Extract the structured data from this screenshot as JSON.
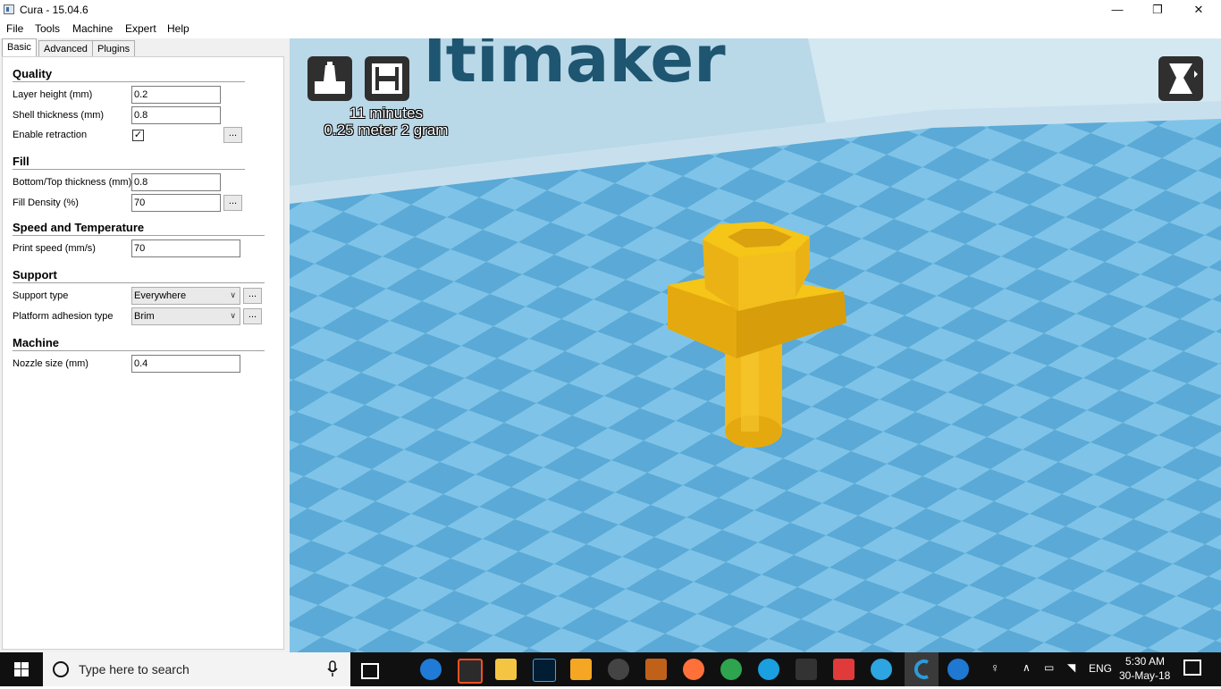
{
  "window": {
    "title": "Cura - 15.04.6",
    "minimize_icon": "minimize-icon",
    "maximize_icon": "restore-icon",
    "close_icon": "close-icon"
  },
  "menu": [
    "File",
    "Tools",
    "Machine",
    "Expert",
    "Help"
  ],
  "tabs": [
    "Basic",
    "Advanced",
    "Plugins"
  ],
  "sections": {
    "quality": {
      "title": "Quality",
      "layer_height_label": "Layer height (mm)",
      "layer_height": "0.2",
      "shell_thickness_label": "Shell thickness (mm)",
      "shell_thickness": "0.8",
      "retraction_label": "Enable retraction",
      "retraction_checked": "✓"
    },
    "fill": {
      "title": "Fill",
      "bottom_top_label": "Bottom/Top thickness (mm)",
      "bottom_top": "0.8",
      "density_label": "Fill Density (%)",
      "density": "70"
    },
    "speed": {
      "title": "Speed and Temperature",
      "print_speed_label": "Print speed (mm/s)",
      "print_speed": "70"
    },
    "support": {
      "title": "Support",
      "support_type_label": "Support type",
      "support_type": "Everywhere",
      "adhesion_label": "Platform adhesion type",
      "adhesion": "Brim"
    },
    "machine": {
      "title": "Machine",
      "nozzle_label": "Nozzle size (mm)",
      "nozzle": "0.4"
    }
  },
  "dots_label": "...",
  "viewport": {
    "print_time": "11 minutes",
    "material": "0.25 meter 2 gram",
    "logo_text": "ltimaker",
    "load_icon": "load-model-icon",
    "save_icon": "save-gcode-icon",
    "view_mode_icon": "view-mode-icon",
    "model_color": "#f5c518",
    "bed_color_light": "#7fc4e8",
    "bed_color_dark": "#5aa9d6"
  },
  "taskbar": {
    "search_placeholder": "Type here to search",
    "language": "ENG",
    "time": "5:30 AM",
    "date": "30-May-18"
  }
}
